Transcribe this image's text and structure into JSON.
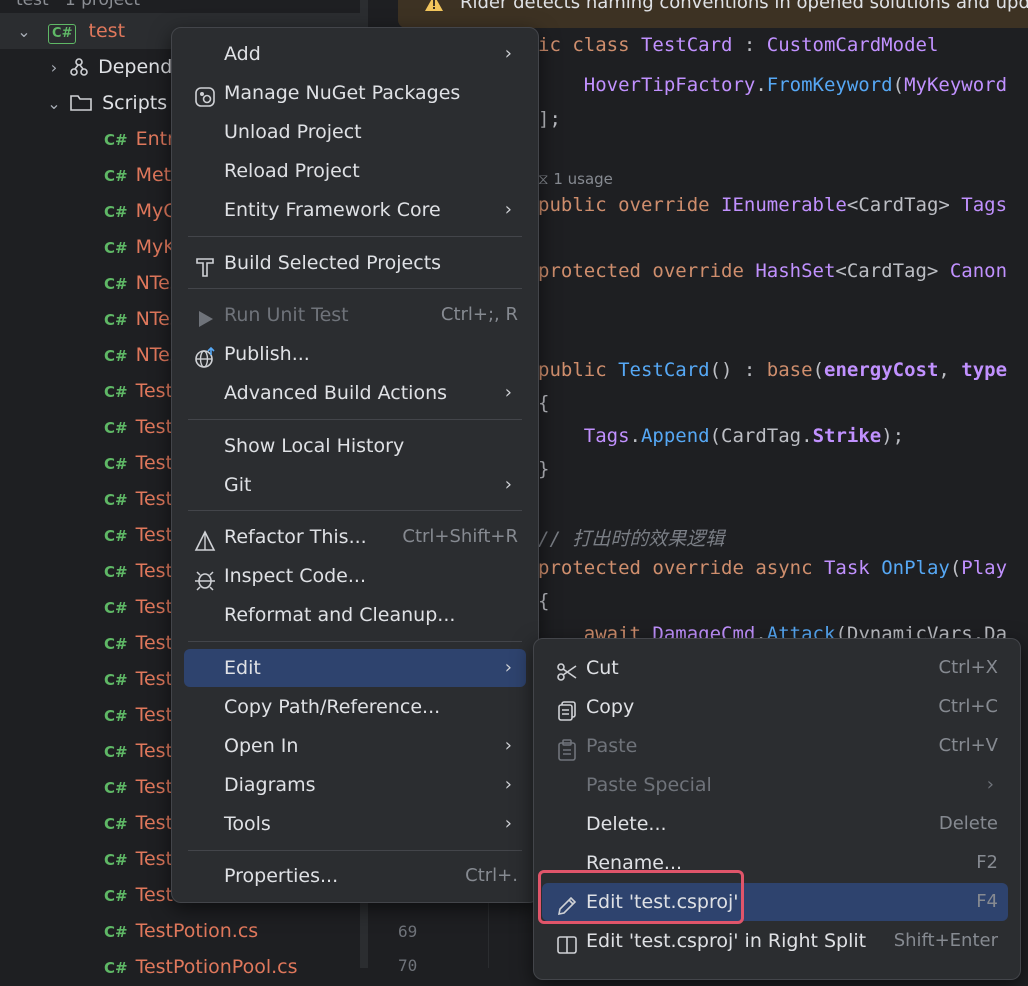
{
  "notice": {
    "text": "Rider detects naming conventions in opened solutions and update"
  },
  "tree": {
    "top_label": "test · 1 project",
    "project": {
      "badge": "C#",
      "name": "test"
    },
    "dependencies": "Dependencies",
    "scripts": "Scripts",
    "files": [
      "Entry",
      "Meta",
      "MyC",
      "MyK",
      "NTes",
      "NTes",
      "NTes",
      "TestA",
      "TestC",
      "TestC",
      "TestC",
      "TestC",
      "TestE",
      "TestE",
      "TestE",
      "TestE",
      "TestE",
      "TestE",
      "TestE",
      "TestC",
      "TestE",
      "TestE",
      "TestPotion.cs",
      "TestPotionPool.cs"
    ],
    "file_badge": "C#"
  },
  "editor": {
    "lines": {
      "l1": "ic class TestCard : CustomCardModel",
      "l2": "    HoverTipFactory.FromKeyword(MyKeyword",
      "l3": "];",
      "l4": "1 usage",
      "l5": "public override IEnumerable<CardTag> Tags",
      "l6": "protected override HashSet<CardTag> Canon",
      "l7": "public TestCard() : base(energyCost, type",
      "l8": "{",
      "l9": "    Tags.Append(CardTag.Strike);",
      "l10": "}",
      "l11": "// 打出时的效果逻辑",
      "l12": "protected override async Task OnPlay(Play",
      "l13": "{",
      "l14": "    await DamageCmd.Attack(DynamicVars.Da"
    },
    "line_numbers": [
      "69",
      "70"
    ]
  },
  "menu": {
    "items": [
      {
        "label": "Add",
        "submenu": true
      },
      {
        "label": "Manage NuGet Packages"
      },
      {
        "label": "Unload Project"
      },
      {
        "label": "Reload Project"
      },
      {
        "label": "Entity Framework Core",
        "submenu": true
      },
      {
        "label": "Build Selected Projects"
      },
      {
        "label": "Run Unit Test",
        "shortcut": "Ctrl+;, R",
        "disabled": true
      },
      {
        "label": "Publish..."
      },
      {
        "label": "Advanced Build Actions",
        "submenu": true
      },
      {
        "label": "Show Local History"
      },
      {
        "label": "Git",
        "submenu": true
      },
      {
        "label": "Refactor This...",
        "shortcut": "Ctrl+Shift+R"
      },
      {
        "label": "Inspect Code..."
      },
      {
        "label": "Reformat and Cleanup..."
      },
      {
        "label": "Edit",
        "submenu": true,
        "selected": true
      },
      {
        "label": "Copy Path/Reference..."
      },
      {
        "label": "Open In",
        "submenu": true
      },
      {
        "label": "Diagrams",
        "submenu": true
      },
      {
        "label": "Tools",
        "submenu": true
      },
      {
        "label": "Properties...",
        "shortcut": "Ctrl+."
      }
    ]
  },
  "submenu": {
    "items": [
      {
        "label": "Cut",
        "shortcut": "Ctrl+X"
      },
      {
        "label": "Copy",
        "shortcut": "Ctrl+C"
      },
      {
        "label": "Paste",
        "shortcut": "Ctrl+V",
        "disabled": true
      },
      {
        "label": "Paste Special",
        "submenu": true,
        "disabled": true
      },
      {
        "label": "Delete...",
        "shortcut": "Delete"
      },
      {
        "label": "Rename...",
        "shortcut": "F2"
      },
      {
        "label": "Edit 'test.csproj'",
        "shortcut": "F4",
        "selected": true
      },
      {
        "label": "Edit 'test.csproj' in Right Split",
        "shortcut": "Shift+Enter"
      }
    ]
  },
  "colors": {
    "accent": "#2e436e",
    "highlight": "#e0556a",
    "file_name": "#e0785c",
    "csharp_badge": "#5fb866"
  }
}
